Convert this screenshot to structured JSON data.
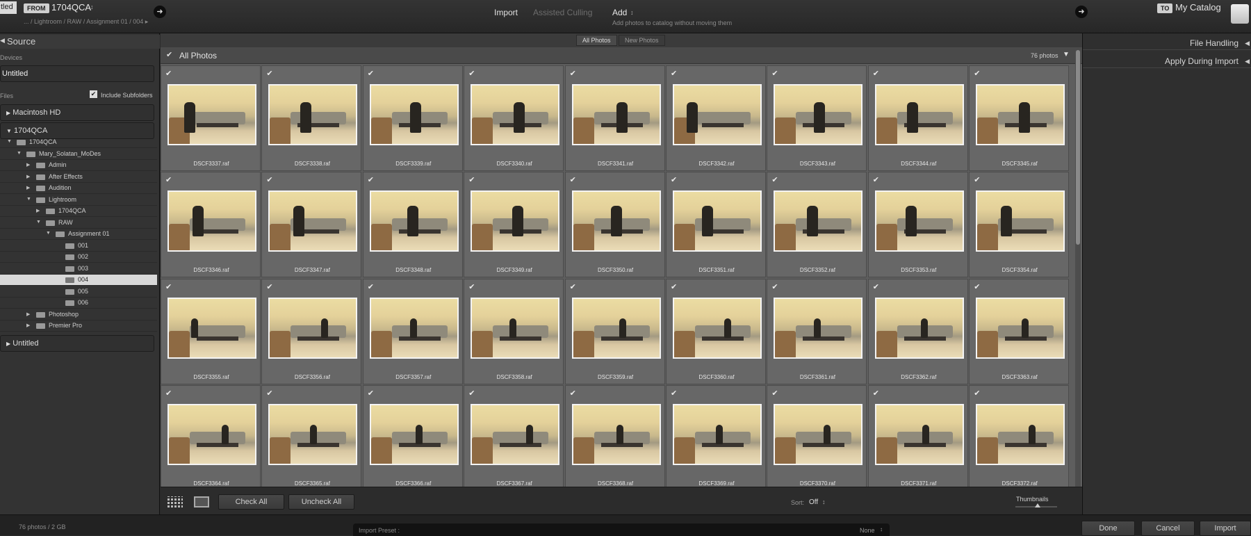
{
  "topbar": {
    "source_label": "tled",
    "from_tag": "FROM",
    "source_name": "1704QCA",
    "source_menu": "↕",
    "source_path": "... / Lightroom / RAW / Assignment 01 / 004 ▸",
    "modes": [
      "Import",
      "Assisted Culling"
    ],
    "add_label": "Add",
    "add_menu": "↕",
    "add_desc": "Add photos to catalog without moving them",
    "to_tag": "TO",
    "catalog_name": "My Catalog"
  },
  "left": {
    "source_title": "Source",
    "devices_label": "Devices",
    "device_untitled": "Untitled",
    "files_label": "Files",
    "include_subfolders": "Include Subfolders",
    "volumes": [
      "Macintosh HD",
      "1704QCA"
    ],
    "bottom_volume": "Untitled",
    "tree": [
      {
        "label": "1704QCA"
      },
      {
        "label": "Mary_Solatan_MoDes"
      },
      {
        "label": "Admin"
      },
      {
        "label": "After Effects"
      },
      {
        "label": "Audition"
      },
      {
        "label": "Lightroom"
      },
      {
        "label": "1704QCA"
      },
      {
        "label": "RAW"
      },
      {
        "label": "Assignment 01"
      },
      {
        "label": "001"
      },
      {
        "label": "002"
      },
      {
        "label": "003"
      },
      {
        "label": "004"
      },
      {
        "label": "005"
      },
      {
        "label": "006"
      },
      {
        "label": "Photoshop"
      },
      {
        "label": "Premier Pro"
      }
    ]
  },
  "center": {
    "tabs": [
      "All Photos",
      "New Photos"
    ],
    "header_title": "All Photos",
    "photo_count": "76 photos",
    "files": [
      "DSCF3337.raf",
      "DSCF3338.raf",
      "DSCF3339.raf",
      "DSCF3340.raf",
      "DSCF3341.raf",
      "DSCF3342.raf",
      "DSCF3343.raf",
      "DSCF3344.raf",
      "DSCF3345.raf",
      "DSCF3346.raf",
      "DSCF3347.raf",
      "DSCF3348.raf",
      "DSCF3349.raf",
      "DSCF3350.raf",
      "DSCF3351.raf",
      "DSCF3352.raf",
      "DSCF3353.raf",
      "DSCF3354.raf",
      "DSCF3355.raf",
      "DSCF3356.raf",
      "DSCF3357.raf",
      "DSCF3358.raf",
      "DSCF3359.raf",
      "DSCF3360.raf",
      "DSCF3361.raf",
      "DSCF3362.raf",
      "DSCF3363.raf",
      "DSCF3364.raf",
      "DSCF3365.raf",
      "DSCF3366.raf",
      "DSCF3367.raf",
      "DSCF3368.raf",
      "DSCF3369.raf",
      "DSCF3370.raf",
      "DSCF3371.raf",
      "DSCF3372.raf"
    ],
    "check_all": "Check All",
    "uncheck_all": "Uncheck All",
    "sort_label": "Sort:",
    "sort_value": "Off",
    "sort_menu": "↕",
    "thumbnails_label": "Thumbnails"
  },
  "right": {
    "file_handling": "File Handling",
    "apply_during_import": "Apply During Import"
  },
  "status": {
    "info": "76 photos / 2 GB",
    "import_preset_label": "Import Preset :",
    "import_preset_value": "None",
    "done": "Done",
    "cancel": "Cancel",
    "import": "Import"
  },
  "icons": [
    "arrow-right-icon",
    "checkmark-icon",
    "disclosure-triangle-icon",
    "folder-icon",
    "grid-view-icon",
    "loupe-view-icon",
    "slider-icon"
  ]
}
